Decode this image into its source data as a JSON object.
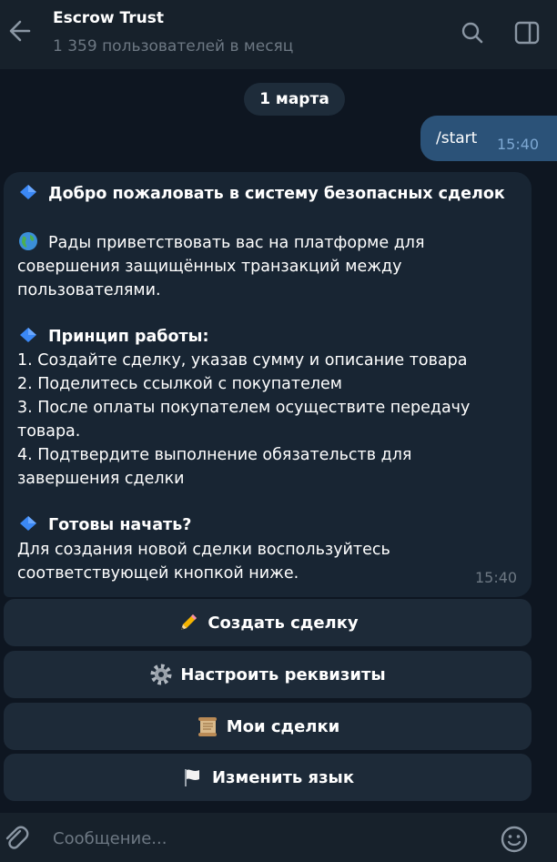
{
  "header": {
    "title": "Escrow Trust",
    "subtitle": "1 359 пользователей в месяц",
    "icons": [
      "back-arrow-icon",
      "search-icon",
      "sidebar-icon"
    ]
  },
  "chat": {
    "date": "1 марта",
    "outgoing": {
      "text": "/start",
      "time": "15:40"
    },
    "incoming": {
      "lines": [
        {
          "text": "Добро пожаловать в систему безопасных сделок",
          "bold": true,
          "emoji": "blue-diamond-icon"
        },
        {
          "text": "Рады приветствовать вас на платформе для",
          "emoji": "globe-icon"
        },
        {
          "text": "совершения защищённых транзакций между"
        },
        {
          "text": "пользователями."
        },
        {
          "text": "Принцип работы:",
          "bold": true,
          "emoji": "blue-diamond-icon"
        },
        {
          "text": "1. Создайте сделку, указав сумму и описание товара"
        },
        {
          "text": "2. Поделитесь ссылкой с покупателем"
        },
        {
          "text": "3. После оплаты покупателем осуществите передачу"
        },
        {
          "text": "товара."
        },
        {
          "text": "4. Подтвердите выполнение обязательств для"
        },
        {
          "text": "завершения сделки"
        },
        {
          "text": "Готовы начать?",
          "bold": true,
          "emoji": "blue-diamond-icon"
        },
        {
          "text": "Для создания новой сделки воспользуйтесь"
        },
        {
          "text": "соответствующей кнопкой ниже."
        }
      ],
      "time": "15:40"
    }
  },
  "keyboard": {
    "buttons": [
      {
        "label": "Создать сделку",
        "icon": "pencil-icon"
      },
      {
        "label": "Настроить реквизиты",
        "icon": "gear-icon"
      },
      {
        "label": "Мои сделки",
        "icon": "scroll-icon"
      },
      {
        "label": "Изменить язык",
        "icon": "white-flag-icon"
      }
    ]
  },
  "composer": {
    "placeholder": "Сообщение...",
    "icons": [
      "paperclip-icon",
      "smiley-icon"
    ]
  },
  "colors": {
    "background": "#0e1621",
    "header": "#17212b",
    "incoming_bubble": "#182533",
    "outgoing_bubble": "#2b5278",
    "keyboard_button": "#1d2a38",
    "muted_text": "#6d7883",
    "outgoing_time": "#7da8d3"
  }
}
